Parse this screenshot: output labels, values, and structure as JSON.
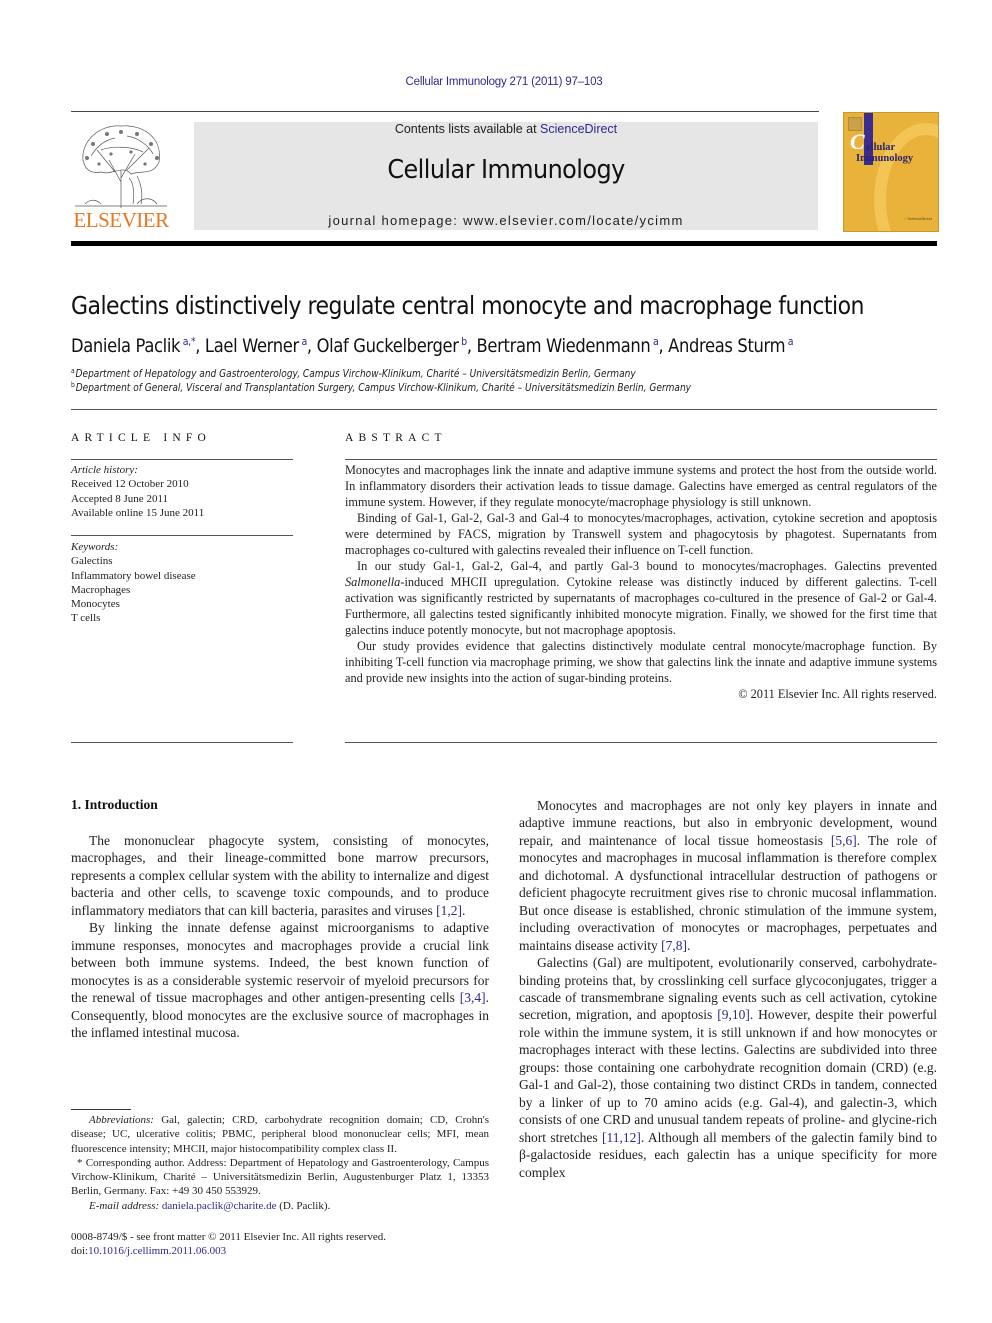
{
  "header": {
    "running_head": "Cellular Immunology 271 (2011) 97–103",
    "publisher_logo_text": "ELSEVIER",
    "contents_prefix": "Contents lists available at ",
    "contents_link": "ScienceDirect",
    "journal_name": "Cellular Immunology",
    "homepage_prefix": "journal homepage: ",
    "homepage_url": "www.elsevier.com/locate/ycimm",
    "cover_title_line1": "ellular",
    "cover_title_line2": "Immunology",
    "cover_initial": "C",
    "colors": {
      "elsevier_orange": "#e87722",
      "link_blue": "#2e2a8c",
      "cover_yellow": "#e9b23a",
      "banner_gray": "#e6e6e6"
    }
  },
  "article": {
    "title": "Galectins distinctively regulate central monocyte and macrophage function",
    "authors": [
      {
        "name": "Daniela Paclik",
        "marks": "a,*",
        "sep": ", "
      },
      {
        "name": "Lael Werner",
        "marks": "a",
        "sep": ", "
      },
      {
        "name": "Olaf Guckelberger",
        "marks": "b",
        "sep": ", "
      },
      {
        "name": "Bertram Wiedenmann",
        "marks": "a",
        "sep": ", "
      },
      {
        "name": "Andreas Sturm",
        "marks": "a",
        "sep": ""
      }
    ],
    "affiliations": [
      {
        "mark": "a",
        "text": "Department of Hepatology and Gastroenterology, Campus Virchow-Klinikum, Charité – Universitätsmedizin Berlin, Germany"
      },
      {
        "mark": "b",
        "text": "Department of General, Visceral and Transplantation Surgery, Campus Virchow-Klinikum, Charité – Universitätsmedizin Berlin, Germany"
      }
    ]
  },
  "article_info": {
    "heading": "ARTICLE INFO",
    "history_label": "Article history:",
    "history": [
      "Received 12 October 2010",
      "Accepted 8 June 2011",
      "Available online 15 June 2011"
    ],
    "keywords_label": "Keywords:",
    "keywords": [
      "Galectins",
      "Inflammatory bowel disease",
      "Macrophages",
      "Monocytes",
      "T cells"
    ]
  },
  "abstract": {
    "heading": "ABSTRACT",
    "p1": "Monocytes and macrophages link the innate and adaptive immune systems and protect the host from the outside world. In inflammatory disorders their activation leads to tissue damage. Galectins have emerged as central regulators of the immune system. However, if they regulate monocyte/macrophage physiology is still unknown.",
    "p2": "Binding of Gal-1, Gal-2, Gal-3 and Gal-4 to monocytes/macrophages, activation, cytokine secretion and apoptosis were determined by FACS, migration by Transwell system and phagocytosis by phagotest. Supernatants from macrophages co-cultured with galectins revealed their influence on T-cell function.",
    "p3_a": "In our study Gal-1, Gal-2, Gal-4, and partly Gal-3 bound to monocytes/macrophages. Galectins prevented ",
    "p3_italic": "Salmonella",
    "p3_b": "-induced MHCII upregulation. Cytokine release was distinctly induced by different galectins. T-cell activation was significantly restricted by supernatants of macrophages co-cultured in the presence of Gal-2 or Gal-4. Furthermore, all galectins tested significantly inhibited monocyte migration. Finally, we showed for the first time that galectins induce potently monocyte, but not macrophage apoptosis.",
    "p4": "Our study provides evidence that galectins distinctively modulate central monocyte/macrophage function. By inhibiting T-cell function via macrophage priming, we show that galectins link the innate and adaptive immune systems and provide new insights into the action of sugar-binding proteins.",
    "copyright": "© 2011 Elsevier Inc. All rights reserved."
  },
  "body": {
    "section_heading": "1. Introduction",
    "left_p1_a": "The mononuclear phagocyte system, consisting of monocytes, macrophages, and their lineage-committed bone marrow precursors, represents a complex cellular system with the ability to internalize and digest bacteria and other cells, to scavenge toxic compounds, and to produce inflammatory mediators that can kill bacteria, parasites and viruses ",
    "left_p1_cite": "[1,2]",
    "left_p1_end": ".",
    "left_p2_a": "By linking the innate defense against microorganisms to adaptive immune responses, monocytes and macrophages provide a crucial link between both immune systems. Indeed, the best known function of monocytes is as a considerable systemic reservoir of myeloid precursors for the renewal of tissue macrophages and other antigen-presenting cells ",
    "left_p2_cite": "[3,4]",
    "left_p2_b": ". Consequently, blood monocytes are the exclusive source of macrophages in the inflamed intestinal mucosa.",
    "right_p1_a": "Monocytes and macrophages are not only key players in innate and adaptive immune reactions, but also in embryonic development, wound repair, and maintenance of local tissue homeostasis ",
    "right_p1_cite1": "[5,6]",
    "right_p1_b": ". The role of monocytes and macrophages in mucosal inflammation is therefore complex and dichotomal. A dysfunctional intracellular destruction of pathogens or deficient phagocyte recruitment gives rise to chronic mucosal inflammation. But once disease is established, chronic stimulation of the immune system, including overactivation of monocytes or macrophages, perpetuates and maintains disease activity ",
    "right_p1_cite2": "[7,8]",
    "right_p1_end": ".",
    "right_p2_a": "Galectins (Gal) are multipotent, evolutionarily conserved, carbohydrate-binding proteins that, by crosslinking cell surface glycoconjugates, trigger a cascade of transmembrane signaling events such as cell activation, cytokine secretion, migration, and apoptosis ",
    "right_p2_cite1": "[9,10]",
    "right_p2_b": ". However, despite their powerful role within the immune system, it is still unknown if and how monocytes or macrophages interact with these lectins. Galectins are subdivided into three groups: those containing one carbohydrate recognition domain (CRD) (e.g. Gal-1 and Gal-2), those containing two distinct CRDs in tandem, connected by a linker of up to 70 amino acids (e.g. Gal-4), and galectin-3, which consists of one CRD and unusual tandem repeats of proline- and glycine-rich short stretches ",
    "right_p2_cite2": "[11,12]",
    "right_p2_c": ". Although all members of the galectin family bind to β-galactoside residues, each galectin has a unique specificity for more complex"
  },
  "footnotes": {
    "abbrev_label": "Abbreviations:",
    "abbrev_text": " Gal, galectin; CRD, carbohydrate recognition domain; CD, Crohn's disease; UC, ulcerative colitis; PBMC, peripheral blood mononuclear cells; MFI, mean fluorescence intensity; MHCII, major histocompatibility complex class II.",
    "corresponding": "* Corresponding author. Address: Department of Hepatology and Gastroenterology, Campus Virchow-Klinikum, Charité – Universitätsmedizin Berlin, Augustenburger Platz 1, 13353 Berlin, Germany. Fax: +49 30 450 553929.",
    "email_label": "E-mail address:",
    "email": "daniela.paclik@charite.de",
    "email_suffix": " (D. Paclik)."
  },
  "imprint": {
    "issn_line": "0008-8749/$ - see front matter © 2011 Elsevier Inc. All rights reserved.",
    "doi_prefix": "doi:",
    "doi": "10.1016/j.cellimm.2011.06.003"
  }
}
